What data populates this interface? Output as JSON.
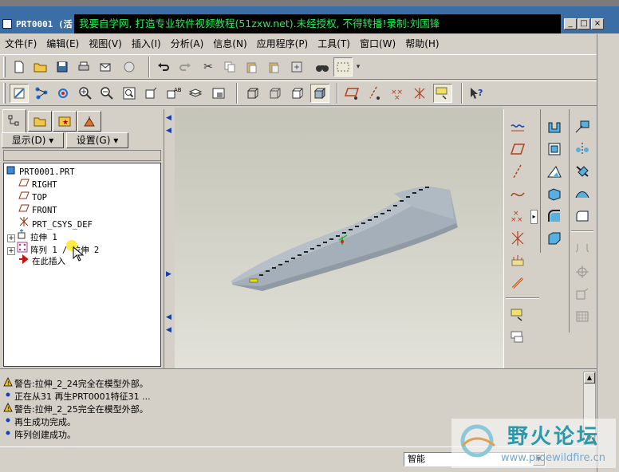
{
  "window": {
    "title": "PRT0001 (活",
    "banner": "我要自学网, 打造专业软件视频教程(51zxw.net).未经授权, 不得转播!录制:刘国锋",
    "controls": [
      "_",
      "□",
      "×"
    ]
  },
  "menubar": {
    "items": [
      "文件(F)",
      "编辑(E)",
      "视图(V)",
      "插入(I)",
      "分析(A)",
      "信息(N)",
      "应用程序(P)",
      "工具(T)",
      "窗口(W)",
      "帮助(H)"
    ]
  },
  "left_panel": {
    "show_button": "显示(D)",
    "settings_button": "设置(G)",
    "tree": [
      {
        "label": "PRT0001.PRT",
        "icon": "part-icon",
        "expander": ""
      },
      {
        "label": "RIGHT",
        "icon": "datum-plane-icon",
        "expander": ""
      },
      {
        "label": "TOP",
        "icon": "datum-plane-icon",
        "expander": ""
      },
      {
        "label": "FRONT",
        "icon": "datum-plane-icon",
        "expander": ""
      },
      {
        "label": "PRT_CSYS_DEF",
        "icon": "csys-icon",
        "expander": ""
      },
      {
        "label": "拉伸 1",
        "icon": "extrude-icon",
        "expander": "+"
      },
      {
        "label": "阵列 1 / 拉伸 2",
        "icon": "pattern-icon",
        "expander": "+"
      },
      {
        "label": "在此插入",
        "icon": "insert-here-arrow-icon",
        "expander": ""
      }
    ]
  },
  "messages": [
    {
      "icon": "warning",
      "text": "警告:拉伸_2_24完全在模型外部。"
    },
    {
      "icon": "info",
      "text": "正在从31 再生PRT0001特征31 ..."
    },
    {
      "icon": "warning",
      "text": "警告:拉伸_2_25完全在模型外部。"
    },
    {
      "icon": "info",
      "text": "再生成功完成。"
    },
    {
      "icon": "info",
      "text": "阵列创建成功。"
    }
  ],
  "status": {
    "filter_value": "智能"
  },
  "watermark": {
    "title": "野火论坛",
    "url": "www.proewildfire.cn"
  },
  "colors": {
    "titlebar": "#3a6ea5",
    "banner_text": "#22ee55",
    "model": "#a9b3bc",
    "warning": "#f0c000",
    "info": "#1040c0"
  }
}
